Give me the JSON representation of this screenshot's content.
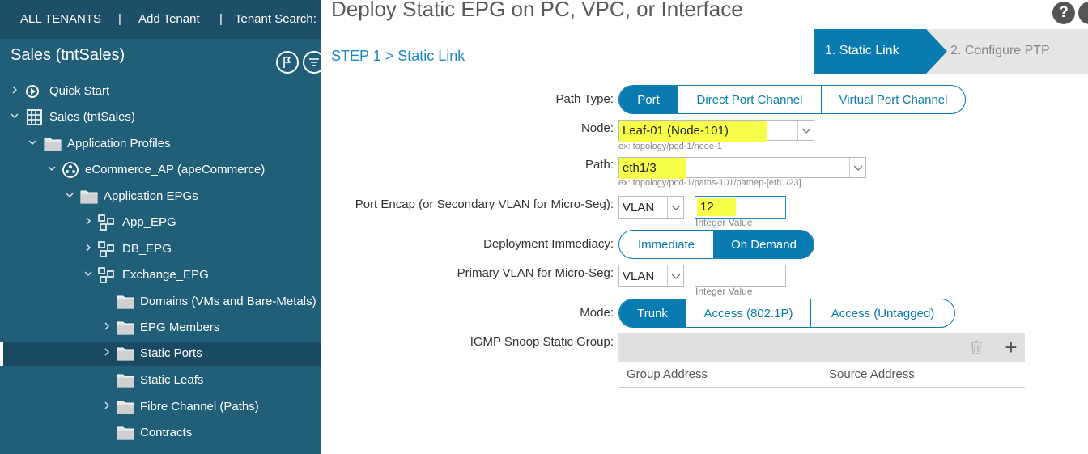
{
  "topbar": {
    "all_tenants": "ALL TENANTS",
    "sep1": "|",
    "add_tenant": "Add Tenant",
    "sep2": "|",
    "tenant_search": "Tenant Search:"
  },
  "sidebar": {
    "tenant_title": "Sales (tntSales)",
    "tree": [
      {
        "label": "Quick Start",
        "icon": "quick-start-icon"
      },
      {
        "label": "Sales (tntSales)",
        "icon": "tenant-icon"
      },
      {
        "label": "Application Profiles",
        "icon": "folder-icon"
      },
      {
        "label": "eCommerce_AP (apeCommerce)",
        "icon": "app-profile-icon"
      },
      {
        "label": "Application EPGs",
        "icon": "folder-icon"
      },
      {
        "label": "App_EPG",
        "icon": "epg-icon"
      },
      {
        "label": "DB_EPG",
        "icon": "epg-icon"
      },
      {
        "label": "Exchange_EPG",
        "icon": "epg-icon"
      },
      {
        "label": "Domains (VMs and Bare-Metals)",
        "icon": "folder-icon"
      },
      {
        "label": "EPG Members",
        "icon": "folder-icon"
      },
      {
        "label": "Static Ports",
        "icon": "folder-icon"
      },
      {
        "label": "Static Leafs",
        "icon": "folder-icon"
      },
      {
        "label": "Fibre Channel (Paths)",
        "icon": "folder-icon"
      },
      {
        "label": "Contracts",
        "icon": "folder-icon"
      }
    ]
  },
  "dialog": {
    "title": "Deploy Static EPG on PC, VPC, or Interface",
    "step_label": "STEP 1 > Static Link",
    "wizard": {
      "step1": "1. Static Link",
      "step2": "2. Configure PTP"
    }
  },
  "form": {
    "path_type": {
      "label": "Path Type:",
      "options": [
        "Port",
        "Direct Port Channel",
        "Virtual Port Channel"
      ],
      "selected": "Port"
    },
    "node": {
      "label": "Node:",
      "value": "Leaf-01 (Node-101)",
      "hint": "ex: topology/pod-1/node-1"
    },
    "path": {
      "label": "Path:",
      "value": "eth1/3",
      "hint": "ex: topology/pod-1/paths-101/pathep-[eth1/23]"
    },
    "port_encap": {
      "label": "Port Encap (or Secondary VLAN for Micro-Seg):",
      "type": "VLAN",
      "value": "12",
      "hint": "Integer Value"
    },
    "deployment_immediacy": {
      "label": "Deployment Immediacy:",
      "options": [
        "Immediate",
        "On Demand"
      ],
      "selected": "On Demand"
    },
    "primary_vlan": {
      "label": "Primary VLAN for Micro-Seg:",
      "type": "VLAN",
      "value": "",
      "hint": "Integer Value"
    },
    "mode": {
      "label": "Mode:",
      "options": [
        "Trunk",
        "Access (802.1P)",
        "Access (Untagged)"
      ],
      "selected": "Trunk"
    },
    "igmp": {
      "label": "IGMP Snoop Static Group:",
      "columns": [
        "Group Address",
        "Source Address"
      ]
    }
  },
  "colors": {
    "sidebar": "#215f79",
    "accent": "#0a7bb0",
    "highlight": "#f7ff4a",
    "wizard_active": "#0a7bb0"
  }
}
